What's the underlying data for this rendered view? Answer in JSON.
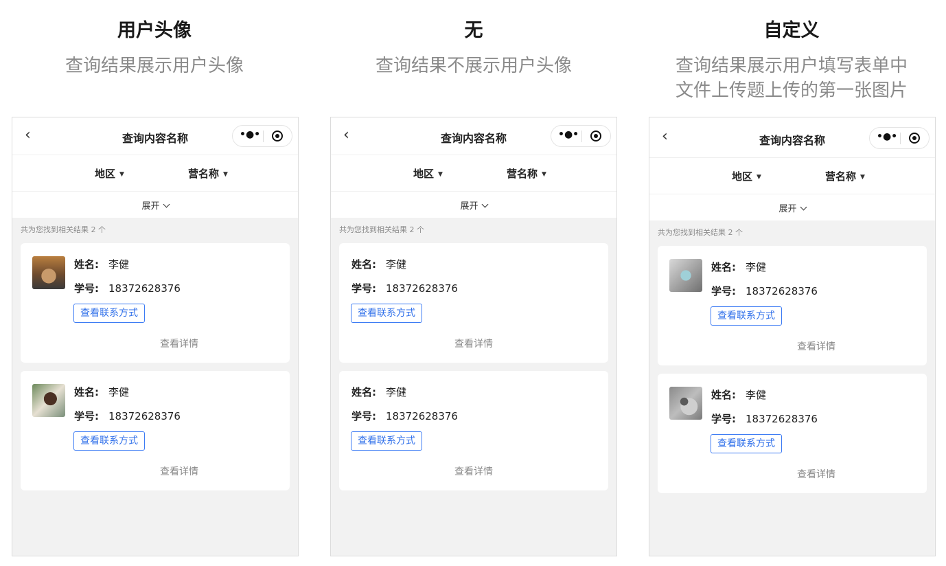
{
  "columns": [
    {
      "title": "用户头像",
      "description": [
        "查询结果展示用户头像"
      ],
      "phone": {
        "nav_title": "查询内容名称",
        "filters": [
          "地区",
          "营名称"
        ],
        "expand_label": "展开",
        "result_count": "共为您找到相关结果 2 个",
        "avatar_style": "photo",
        "cards": [
          {
            "name_label": "姓名:",
            "name": "李健",
            "id_label": "学号:",
            "id": "18372628376",
            "contact_button": "查看联系方式",
            "detail_link": "查看详情"
          },
          {
            "name_label": "姓名:",
            "name": "李健",
            "id_label": "学号:",
            "id": "18372628376",
            "contact_button": "查看联系方式",
            "detail_link": "查看详情"
          }
        ]
      }
    },
    {
      "title": "无",
      "description": [
        "查询结果不展示用户头像"
      ],
      "phone": {
        "nav_title": "查询内容名称",
        "filters": [
          "地区",
          "营名称"
        ],
        "expand_label": "展开",
        "result_count": "共为您找到相关结果 2 个",
        "avatar_style": "none",
        "cards": [
          {
            "name_label": "姓名:",
            "name": "李健",
            "id_label": "学号:",
            "id": "18372628376",
            "contact_button": "查看联系方式",
            "detail_link": "查看详情"
          },
          {
            "name_label": "姓名:",
            "name": "李健",
            "id_label": "学号:",
            "id": "18372628376",
            "contact_button": "查看联系方式",
            "detail_link": "查看详情"
          }
        ]
      }
    },
    {
      "title": "自定义",
      "description": [
        "查询结果展示用户填写表单中",
        "文件上传题上传的第一张图片"
      ],
      "phone": {
        "nav_title": "查询内容名称",
        "filters": [
          "地区",
          "营名称"
        ],
        "expand_label": "展开",
        "result_count": "共为您找到相关结果 2 个",
        "avatar_style": "uploaded-image",
        "cards": [
          {
            "name_label": "姓名:",
            "name": "李健",
            "id_label": "学号:",
            "id": "18372628376",
            "contact_button": "查看联系方式",
            "detail_link": "查看详情"
          },
          {
            "name_label": "姓名:",
            "name": "李健",
            "id_label": "学号:",
            "id": "18372628376",
            "contact_button": "查看联系方式",
            "detail_link": "查看详情"
          }
        ]
      }
    }
  ],
  "icons": {
    "back": "chevron-left-icon",
    "more": "more-dots-icon",
    "close": "target-circle-icon",
    "dropdown": "caret-down-icon",
    "expand": "chevron-down-icon"
  },
  "colors": {
    "accent": "#3d7cf4",
    "muted_text": "#8a8a8a",
    "page_bg": "#f2f2f2"
  }
}
